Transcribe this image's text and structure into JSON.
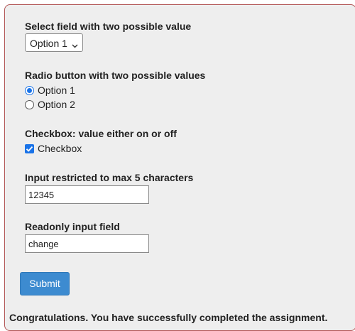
{
  "form": {
    "select_label": "Select field with two possible value",
    "select_value": "Option 1",
    "radio_label": "Radio button with two possible values",
    "radio_options": [
      "Option 1",
      "Option 2"
    ],
    "radio_selected": "Option 1",
    "checkbox_label": "Checkbox: value either on or off",
    "checkbox_text": "Checkbox",
    "checkbox_checked": true,
    "max5_label": "Input restricted to max 5 characters",
    "max5_value": "12345",
    "readonly_label": "Readonly input field",
    "readonly_value": "change",
    "submit_label": "Submit"
  },
  "message": "Congratulations. You have successfully completed the assignment.",
  "colors": {
    "panel_bg": "#eeeeee",
    "panel_border": "#b25656",
    "accent": "#1a73e8",
    "button_bg": "#3d8bd0"
  },
  "icons": {
    "select_arrow": "chevron-down-icon",
    "checkbox_mark": "check-icon"
  }
}
